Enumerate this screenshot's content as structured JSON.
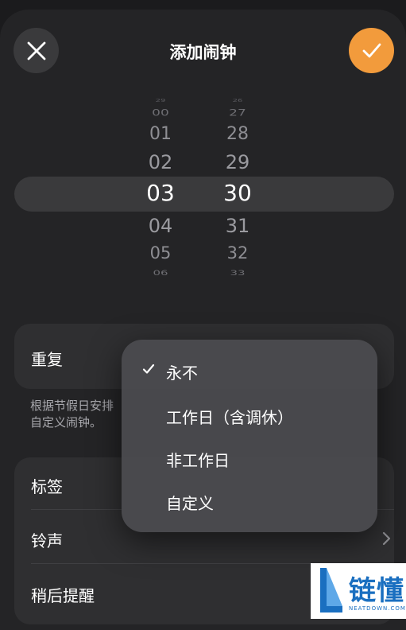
{
  "header": {
    "title": "添加闹钟",
    "close_icon": "close-icon",
    "confirm_icon": "checkmark-icon",
    "confirm_color": "#f29b3c"
  },
  "time_picker": {
    "hours": [
      "29",
      "00",
      "01",
      "02",
      "03",
      "04",
      "05",
      "06"
    ],
    "minutes": [
      "26",
      "27",
      "28",
      "29",
      "30",
      "31",
      "32",
      "33"
    ],
    "selected_hour": "03",
    "selected_minute": "30"
  },
  "repeat": {
    "label": "重复"
  },
  "hint": {
    "text": "根据节假日安排\n自定义闹钟。"
  },
  "settings": {
    "label_row": "标签",
    "ringtone_row": "铃声",
    "snooze_row": "稍后提醒"
  },
  "repeat_menu": {
    "options": [
      "永不",
      "工作日（含调休）",
      "非工作日",
      "自定义"
    ],
    "selected": "永不"
  },
  "watermark": {
    "brand": "链懂",
    "sub": "NEATDOWN.COM"
  }
}
